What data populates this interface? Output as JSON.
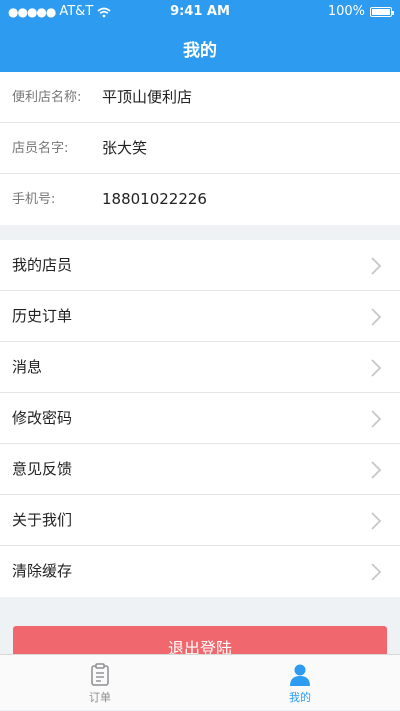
{
  "status_bar": {
    "carrier": "AT&T",
    "time": "9:41 AM",
    "battery": "100%"
  },
  "header": {
    "title": "我的"
  },
  "info": [
    {
      "label": "便利店名称:",
      "value": "平顶山便利店"
    },
    {
      "label": "店员名字:",
      "value": "张大笑"
    },
    {
      "label": "手机号:",
      "value": "18801022226"
    }
  ],
  "menu": [
    {
      "label": "我的店员"
    },
    {
      "label": "历史订单"
    },
    {
      "label": "消息"
    },
    {
      "label": "修改密码"
    },
    {
      "label": "意见反馈"
    },
    {
      "label": "关于我们"
    },
    {
      "label": "清除缓存"
    }
  ],
  "logout": {
    "label": "退出登陆"
  },
  "tabs": [
    {
      "label": "订单",
      "icon": "order-list-icon",
      "active": false
    },
    {
      "label": "我的",
      "icon": "person-icon",
      "active": true
    }
  ],
  "colors": {
    "primary": "#2d9bf0",
    "danger": "#f0686d",
    "background": "#eef2f5"
  }
}
